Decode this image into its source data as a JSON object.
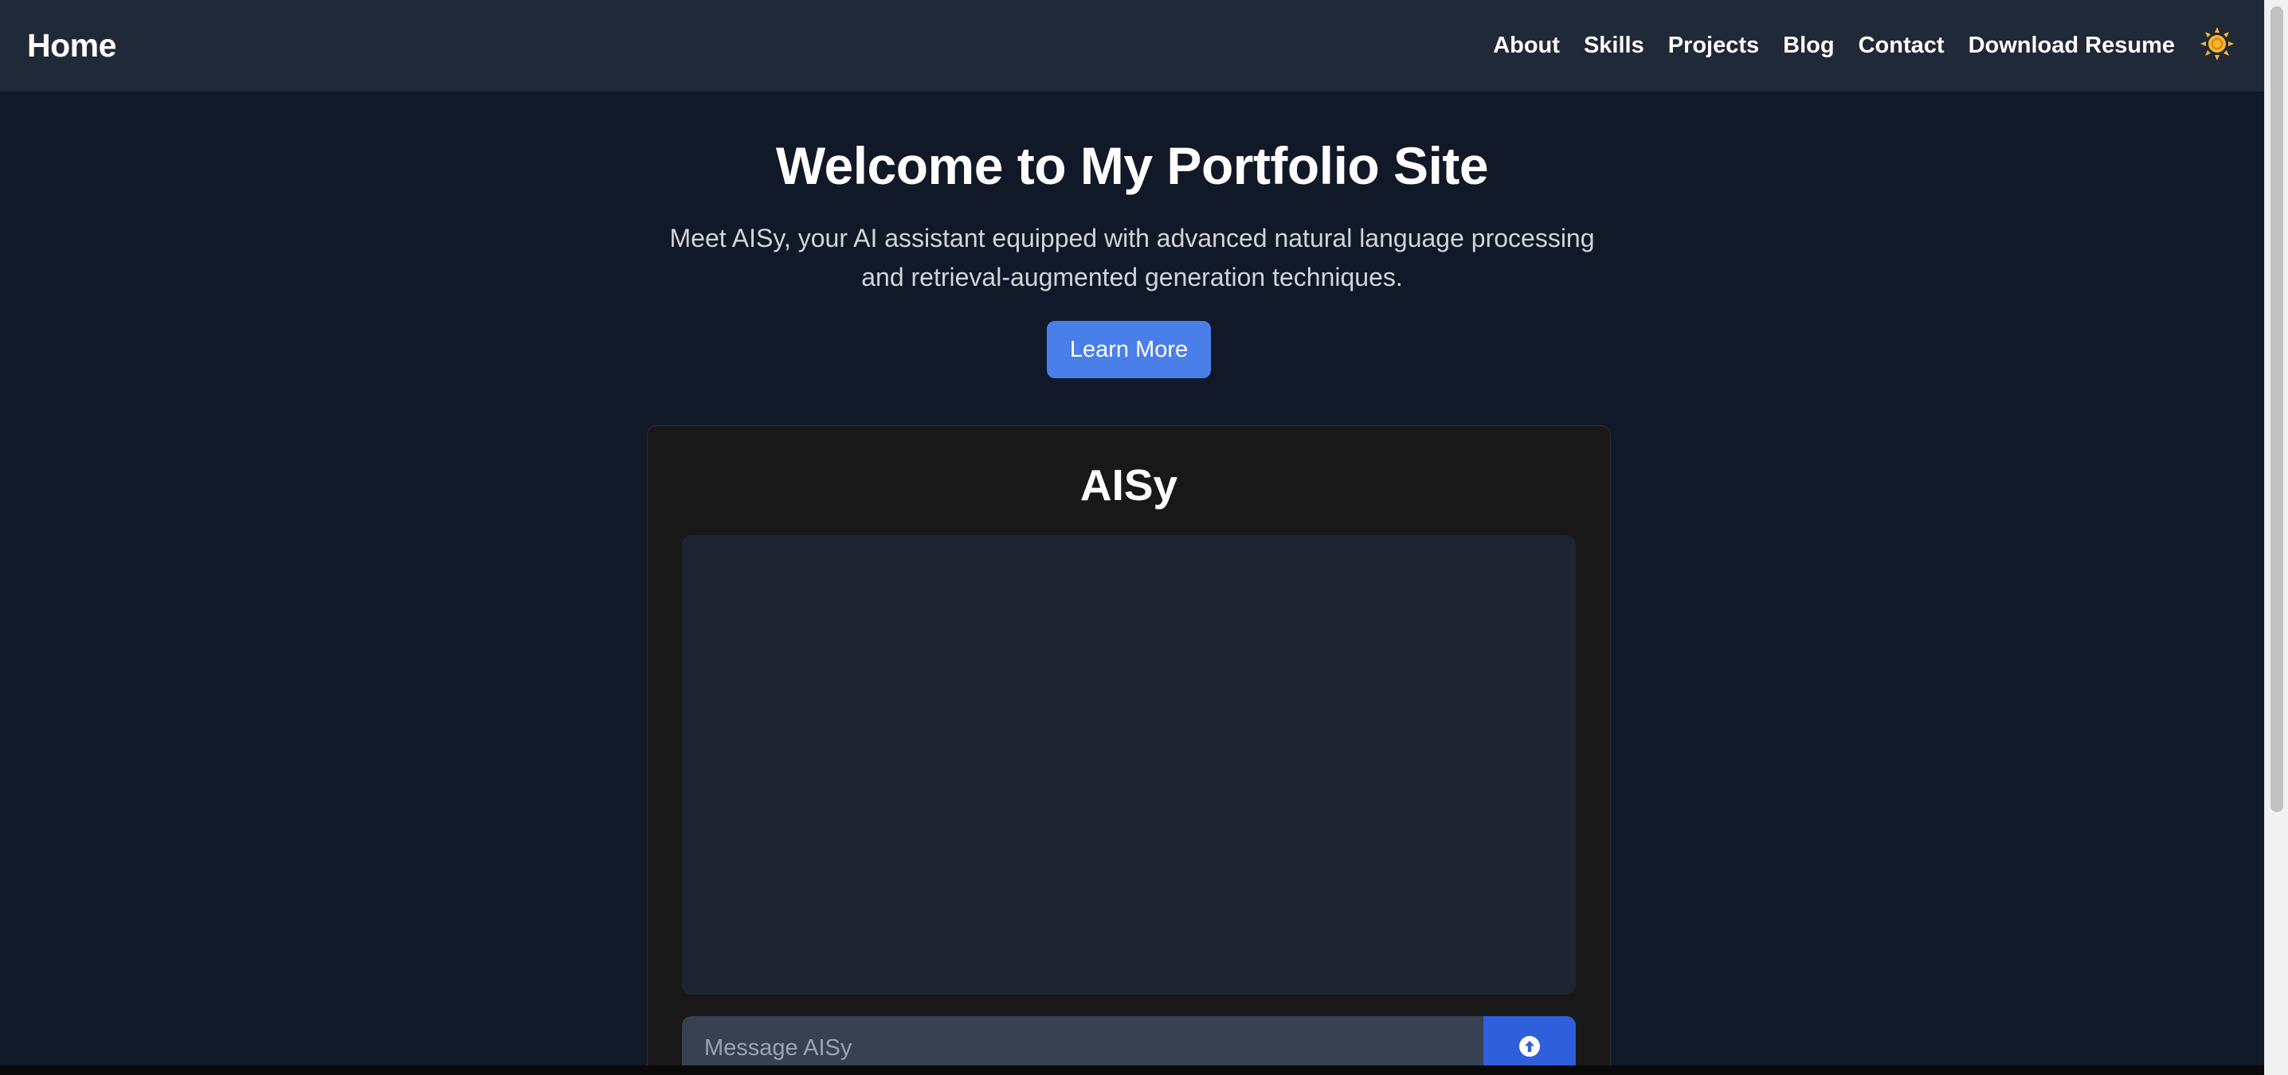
{
  "navbar": {
    "brand": "Home",
    "links": [
      {
        "label": "About"
      },
      {
        "label": "Skills"
      },
      {
        "label": "Projects"
      },
      {
        "label": "Blog"
      },
      {
        "label": "Contact"
      },
      {
        "label": "Download Resume"
      }
    ],
    "theme_icon": "sun-icon",
    "theme_icon_color": "#f5b82e"
  },
  "hero": {
    "title": "Welcome to My Portfolio Site",
    "subtitle_line1": "Meet AISy, your AI assistant equipped with advanced natural language processing",
    "subtitle_line2": "and retrieval-augmented generation techniques.",
    "cta_label": "Learn More"
  },
  "chat": {
    "title": "AISy",
    "input_placeholder": "Message AISy",
    "input_value": "",
    "send_icon": "arrow-up-circle-icon"
  },
  "colors": {
    "background": "#111827",
    "navbar": "#1f2937",
    "accent": "#4a7fea",
    "send_button": "#2f5fdb",
    "card": "#181818",
    "chat_history": "#1f2433",
    "input": "#374151"
  }
}
